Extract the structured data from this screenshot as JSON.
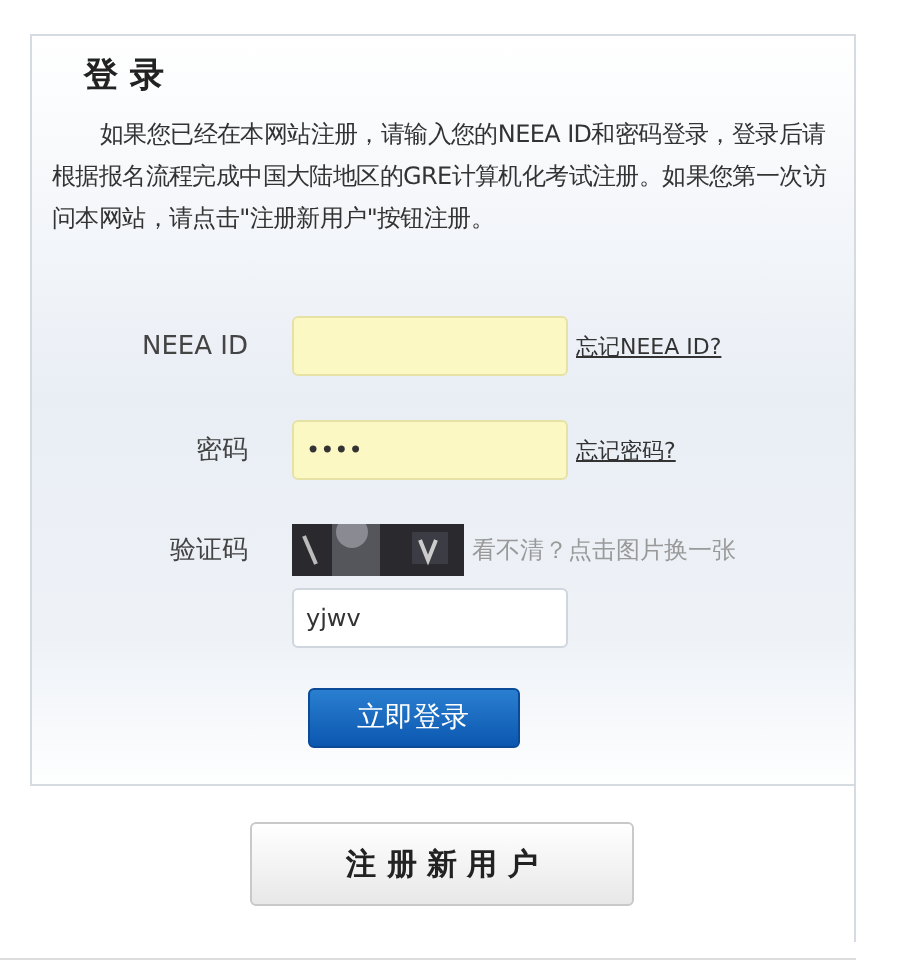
{
  "title": "登 录",
  "intro": "如果您已经在本网站注册，请输入您的NEEA ID和密码登录，登录后请根据报名流程完成中国大陆地区的GRE计算机化考试注册。如果您第一次访问本网站，请点击\"注册新用户\"按钮注册。",
  "fields": [
    {
      "kind": "text",
      "label": "NEEA ID",
      "highlighted": true,
      "link": "忘记NEEA ID?"
    },
    {
      "kind": "password",
      "label": "密码",
      "value": "••••",
      "highlighted": true,
      "link": "忘记密码?"
    },
    {
      "kind": "captcha",
      "label": "验证码",
      "hint": "看不清？点击图片换一张",
      "value": "yjwv",
      "highlighted": false
    }
  ],
  "login_button": "立即登录",
  "register_button": "注 册 新 用 户"
}
